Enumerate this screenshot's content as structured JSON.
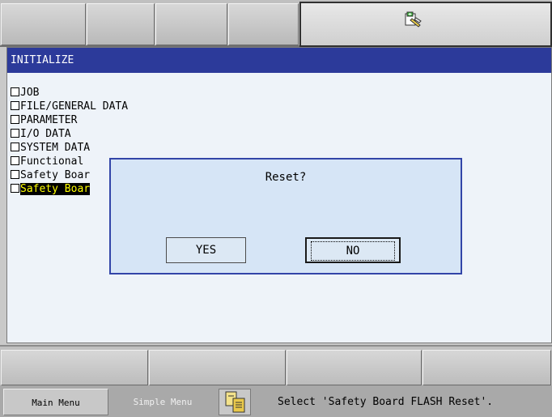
{
  "window": {
    "title": "INITIALIZE"
  },
  "items": [
    {
      "label": "JOB"
    },
    {
      "label": "FILE/GENERAL DATA"
    },
    {
      "label": "PARAMETER"
    },
    {
      "label": "I/O DATA"
    },
    {
      "label": "SYSTEM DATA"
    },
    {
      "label": "Functional"
    },
    {
      "label": "Safety Boar"
    },
    {
      "label": "Safety Boar",
      "selected": true
    }
  ],
  "dialog": {
    "message": "Reset?",
    "yes_label": "YES",
    "no_label": "NO"
  },
  "statusbar": {
    "main_menu": "Main Menu",
    "simple_menu": "Simple Menu",
    "message": "Select 'Safety Board FLASH Reset'."
  },
  "colors": {
    "title_bg": "#2c3a9a",
    "dialog_bg": "#d6e5f6",
    "window_bg": "#eef3f9",
    "selected_text": "#ffff00"
  },
  "icons": {
    "top_tab": "document-edit-icon",
    "status": "clipboard-icon"
  }
}
